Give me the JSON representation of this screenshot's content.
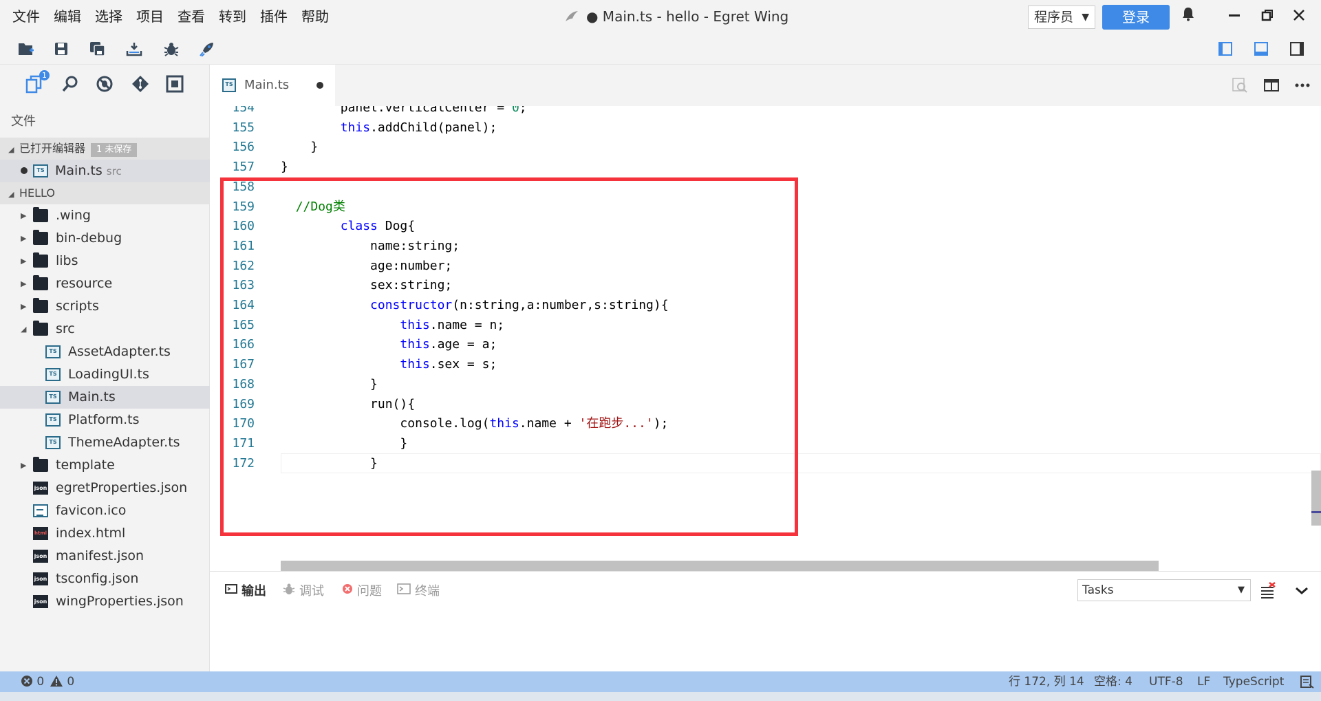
{
  "menu": [
    "文件",
    "编辑",
    "选择",
    "项目",
    "查看",
    "转到",
    "插件",
    "帮助"
  ],
  "window_title": "● Main.ts - hello - Egret Wing",
  "role_select": {
    "value": "程序员"
  },
  "login_label": "登录",
  "explorer_badge": "1",
  "explorer_title": "文件",
  "open_editors": {
    "label": "已打开编辑器",
    "unsaved": "1 未保存",
    "file": "Main.ts",
    "path": "src"
  },
  "project": {
    "label": "HELLO"
  },
  "tree": [
    {
      "label": ".wing",
      "type": "folder",
      "depth": 0,
      "arrow": "right"
    },
    {
      "label": "bin-debug",
      "type": "folder",
      "depth": 0,
      "arrow": "right"
    },
    {
      "label": "libs",
      "type": "folder",
      "depth": 0,
      "arrow": "right"
    },
    {
      "label": "resource",
      "type": "folder",
      "depth": 0,
      "arrow": "right"
    },
    {
      "label": "scripts",
      "type": "folder",
      "depth": 0,
      "arrow": "right"
    },
    {
      "label": "src",
      "type": "folder-open",
      "depth": 0,
      "arrow": "down"
    },
    {
      "label": "AssetAdapter.ts",
      "type": "ts",
      "depth": 1
    },
    {
      "label": "LoadingUI.ts",
      "type": "ts",
      "depth": 1
    },
    {
      "label": "Main.ts",
      "type": "ts",
      "depth": 1,
      "selected": true
    },
    {
      "label": "Platform.ts",
      "type": "ts",
      "depth": 1
    },
    {
      "label": "ThemeAdapter.ts",
      "type": "ts",
      "depth": 1
    },
    {
      "label": "template",
      "type": "folder",
      "depth": 0,
      "arrow": "right"
    },
    {
      "label": "egretProperties.json",
      "type": "json",
      "depth": 0
    },
    {
      "label": "favicon.ico",
      "type": "file",
      "depth": 0
    },
    {
      "label": "index.html",
      "type": "html",
      "depth": 0
    },
    {
      "label": "manifest.json",
      "type": "json",
      "depth": 0
    },
    {
      "label": "tsconfig.json",
      "type": "json",
      "depth": 0
    },
    {
      "label": "wingProperties.json",
      "type": "json",
      "depth": 0
    }
  ],
  "tab": {
    "label": "Main.ts",
    "icon": "ts-file-icon"
  },
  "code": [
    {
      "n": "154",
      "tokens": [
        [
          "t",
          "        panel.verticalCenter = "
        ],
        [
          "num",
          "0"
        ],
        [
          "t",
          ";"
        ]
      ]
    },
    {
      "n": "155",
      "tokens": [
        [
          "t",
          "        "
        ],
        [
          "kw",
          "this"
        ],
        [
          "t",
          ".addChild(panel);"
        ]
      ]
    },
    {
      "n": "156",
      "tokens": [
        [
          "t",
          "    }"
        ]
      ]
    },
    {
      "n": "157",
      "tokens": [
        [
          "t",
          "}"
        ]
      ]
    },
    {
      "n": "158",
      "tokens": []
    },
    {
      "n": "159",
      "tokens": [
        [
          "t",
          "  "
        ],
        [
          "cm",
          "//Dog类"
        ]
      ]
    },
    {
      "n": "160",
      "tokens": [
        [
          "t",
          "        "
        ],
        [
          "kw",
          "class"
        ],
        [
          "t",
          " Dog{"
        ]
      ]
    },
    {
      "n": "161",
      "tokens": [
        [
          "t",
          "            name:string;"
        ]
      ]
    },
    {
      "n": "162",
      "tokens": [
        [
          "t",
          "            age:number;"
        ]
      ]
    },
    {
      "n": "163",
      "tokens": [
        [
          "t",
          "            sex:string;"
        ]
      ]
    },
    {
      "n": "164",
      "tokens": [
        [
          "t",
          "            "
        ],
        [
          "kw",
          "constructor"
        ],
        [
          "t",
          "(n:string,a:number,s:string){"
        ]
      ]
    },
    {
      "n": "165",
      "tokens": [
        [
          "t",
          "                "
        ],
        [
          "kw",
          "this"
        ],
        [
          "t",
          ".name = n;"
        ]
      ]
    },
    {
      "n": "166",
      "tokens": [
        [
          "t",
          "                "
        ],
        [
          "kw",
          "this"
        ],
        [
          "t",
          ".age = a;"
        ]
      ]
    },
    {
      "n": "167",
      "tokens": [
        [
          "t",
          "                "
        ],
        [
          "kw",
          "this"
        ],
        [
          "t",
          ".sex = s;"
        ]
      ]
    },
    {
      "n": "168",
      "tokens": [
        [
          "t",
          "            }"
        ]
      ]
    },
    {
      "n": "169",
      "tokens": [
        [
          "t",
          "            run(){"
        ]
      ]
    },
    {
      "n": "170",
      "tokens": [
        [
          "t",
          "                console.log("
        ],
        [
          "kw",
          "this"
        ],
        [
          "t",
          ".name + "
        ],
        [
          "str",
          "'在跑步...'"
        ],
        [
          "t",
          ");"
        ]
      ]
    },
    {
      "n": "171",
      "tokens": [
        [
          "t",
          "                }"
        ]
      ]
    },
    {
      "n": "172",
      "tokens": [
        [
          "t",
          "            }"
        ]
      ]
    }
  ],
  "panel_tabs": [
    {
      "label": "输出",
      "icon": "output-icon",
      "active": true
    },
    {
      "label": "调试",
      "icon": "debug-icon",
      "active": false
    },
    {
      "label": "问题",
      "icon": "problems-icon",
      "active": false
    },
    {
      "label": "终端",
      "icon": "terminal-icon",
      "active": false
    }
  ],
  "task_select": {
    "value": "Tasks"
  },
  "status": {
    "errors": "0",
    "warnings": "0",
    "position": "行 172, 列 14",
    "indent": "空格: 4",
    "encoding": "UTF-8",
    "eol": "LF",
    "language": "TypeScript"
  },
  "colors": {
    "accent": "#3e8ae6",
    "statusbar": "#a9c9f0",
    "highlight_box": "#f4333c"
  }
}
